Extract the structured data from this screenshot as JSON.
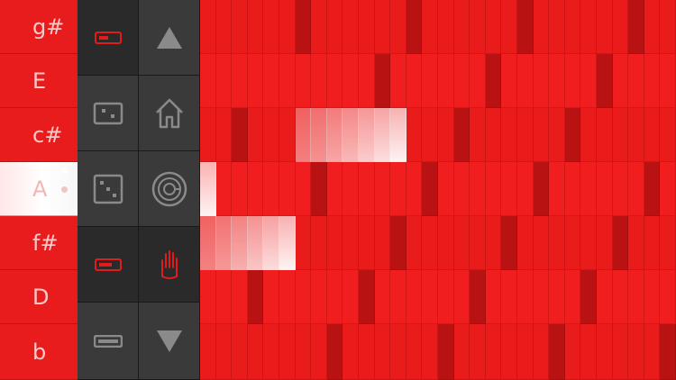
{
  "keyboard": {
    "keys": [
      {
        "label": "g#",
        "name": "key-g-sharp"
      },
      {
        "label": "E",
        "name": "key-e"
      },
      {
        "label": "c#",
        "name": "key-c-sharp"
      },
      {
        "label": "A",
        "name": "key-a",
        "active": true
      },
      {
        "label": "f#",
        "name": "key-f-sharp"
      },
      {
        "label": "D",
        "name": "key-d"
      },
      {
        "label": "b",
        "name": "key-b"
      }
    ]
  },
  "toolbar": {
    "buttons": [
      {
        "name": "pattern-toggle-button",
        "icon": "toggle-switch-icon"
      },
      {
        "name": "scroll-up-button",
        "icon": "arrow-up-icon"
      },
      {
        "name": "dice-button-small",
        "icon": "dice-icon"
      },
      {
        "name": "home-button",
        "icon": "home-icon"
      },
      {
        "name": "dice-button",
        "icon": "dice-icon"
      },
      {
        "name": "spiral-button",
        "icon": "spiral-icon"
      },
      {
        "name": "toggle-active-button",
        "icon": "toggle-switch-icon"
      },
      {
        "name": "hand-tool-button",
        "icon": "hand-icon"
      },
      {
        "name": "toggle-off-button",
        "icon": "toggle-switch-icon"
      },
      {
        "name": "scroll-down-button",
        "icon": "arrow-down-icon"
      }
    ]
  },
  "colors": {
    "accent": "#ee1c1c",
    "accent_dark": "#b81010",
    "toolbar": "#3a3a3a",
    "icon_gray": "#8a8a8a",
    "icon_red": "#e21b1b"
  }
}
